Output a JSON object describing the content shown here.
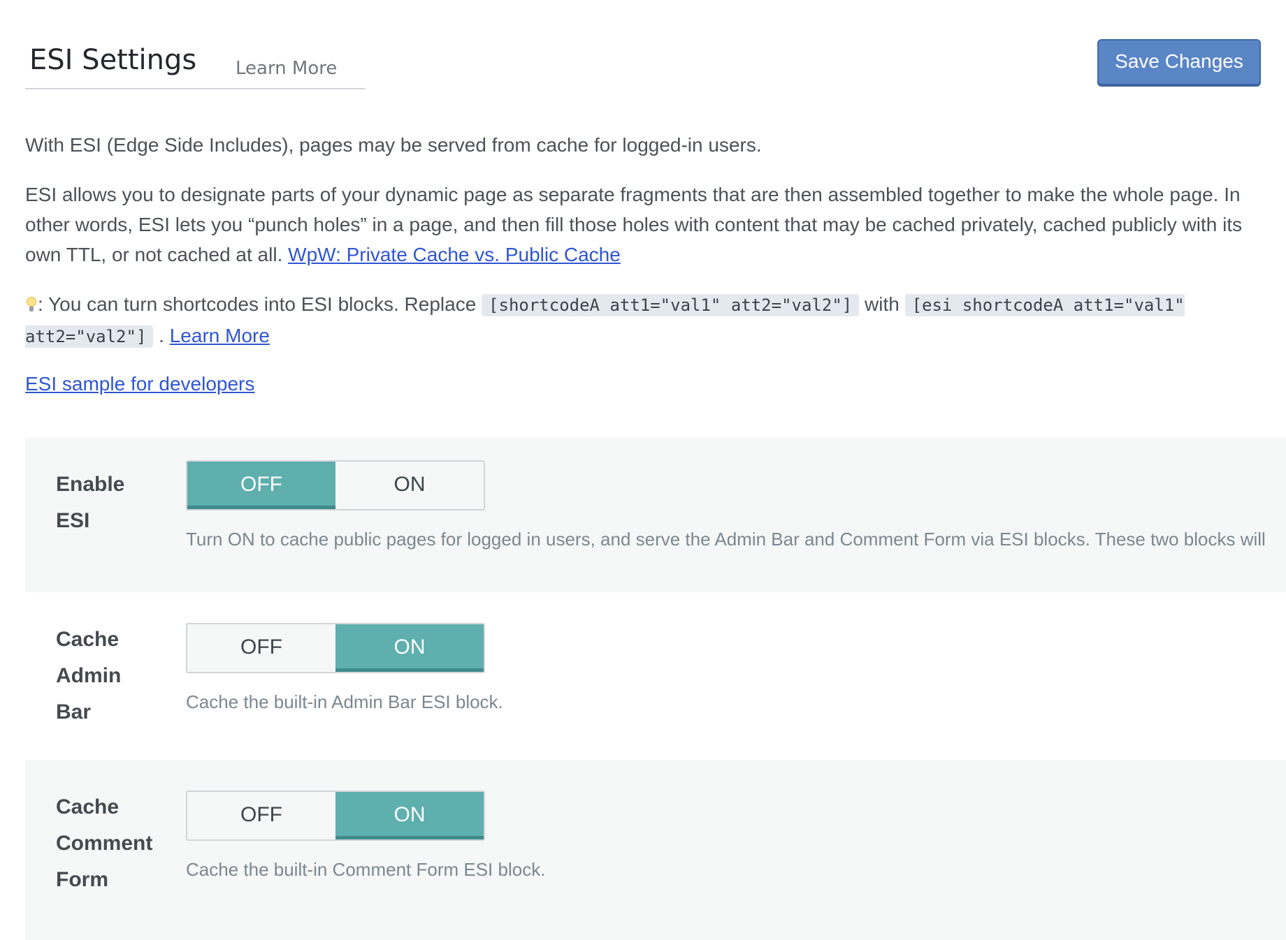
{
  "header": {
    "title": "ESI Settings",
    "learn_more": "Learn More",
    "save_label": "Save Changes"
  },
  "intro": {
    "line1": "With ESI (Edge Side Includes), pages may be served from cache for logged-in users.",
    "para2_text": "ESI allows you to designate parts of your dynamic page as separate fragments that are then assembled together to make the whole page. In other words, ESI lets you “punch holes” in a page, and then fill those holes with content that may be cached privately, cached publicly with its own TTL, or not cached at all.",
    "para2_link": "WpW: Private Cache vs. Public Cache",
    "tip_prefix": ": You can turn shortcodes into ESI blocks. Replace",
    "tip_code1": "[shortcodeA att1=\"val1\" att2=\"val2\"]",
    "tip_with": "with",
    "tip_code2": "[esi shortcodeA att1=\"val1\" att2=\"val2\"]",
    "tip_sep": ".",
    "tip_link": "Learn More",
    "dev_link": "ESI sample for developers"
  },
  "settings": [
    {
      "label": "Enable ESI",
      "off_label": "OFF",
      "on_label": "ON",
      "state": "OFF",
      "description": "Turn ON to cache public pages for logged in users, and serve the Admin Bar and Comment Form via ESI blocks. These two blocks will"
    },
    {
      "label": "Cache Admin Bar",
      "off_label": "OFF",
      "on_label": "ON",
      "state": "ON",
      "description": "Cache the built-in Admin Bar ESI block."
    },
    {
      "label": "Cache Comment Form",
      "off_label": "OFF",
      "on_label": "ON",
      "state": "ON",
      "description": "Cache the built-in Comment Form ESI block."
    }
  ],
  "colors": {
    "toggle_active": "#5eafae",
    "save_button": "#5b86c6",
    "link": "#2f55d4"
  }
}
